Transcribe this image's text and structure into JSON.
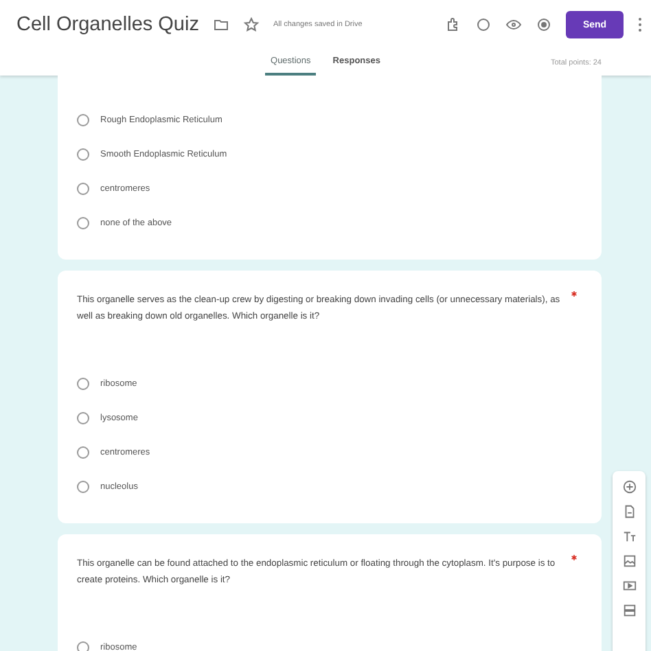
{
  "header": {
    "title": "Cell Organelles Quiz",
    "save_status": "All changes saved in Drive",
    "send_label": "Send"
  },
  "tabs": [
    {
      "label": "Questions",
      "selected": true
    },
    {
      "label": "Responses",
      "selected": false
    }
  ],
  "total_points": "Total points: 24",
  "questions": [
    {
      "required": false,
      "options": [
        {
          "label": "Rough Endoplasmic Reticulum",
          "selected": false
        },
        {
          "label": "Smooth Endoplasmic Reticulum",
          "selected": false
        },
        {
          "label": "centromeres",
          "selected": false
        },
        {
          "label": "none of the above",
          "selected": false
        }
      ]
    },
    {
      "text": "This organelle serves as the clean-up crew by digesting or breaking down invading cells (or unnecessary materials), as well as breaking down old organelles.  Which organelle is it?",
      "required": true,
      "options": [
        {
          "label": "ribosome",
          "selected": false
        },
        {
          "label": "lysosome",
          "selected": false
        },
        {
          "label": "centromeres",
          "selected": false
        },
        {
          "label": "nucleolus",
          "selected": false
        }
      ]
    },
    {
      "text": "This organelle can be found attached to the endoplasmic reticulum or floating through the cytoplasm.  It's purpose is to create proteins.  Which organelle is it?",
      "required": true,
      "options": [
        {
          "label": "ribosome",
          "selected": false
        }
      ]
    }
  ]
}
